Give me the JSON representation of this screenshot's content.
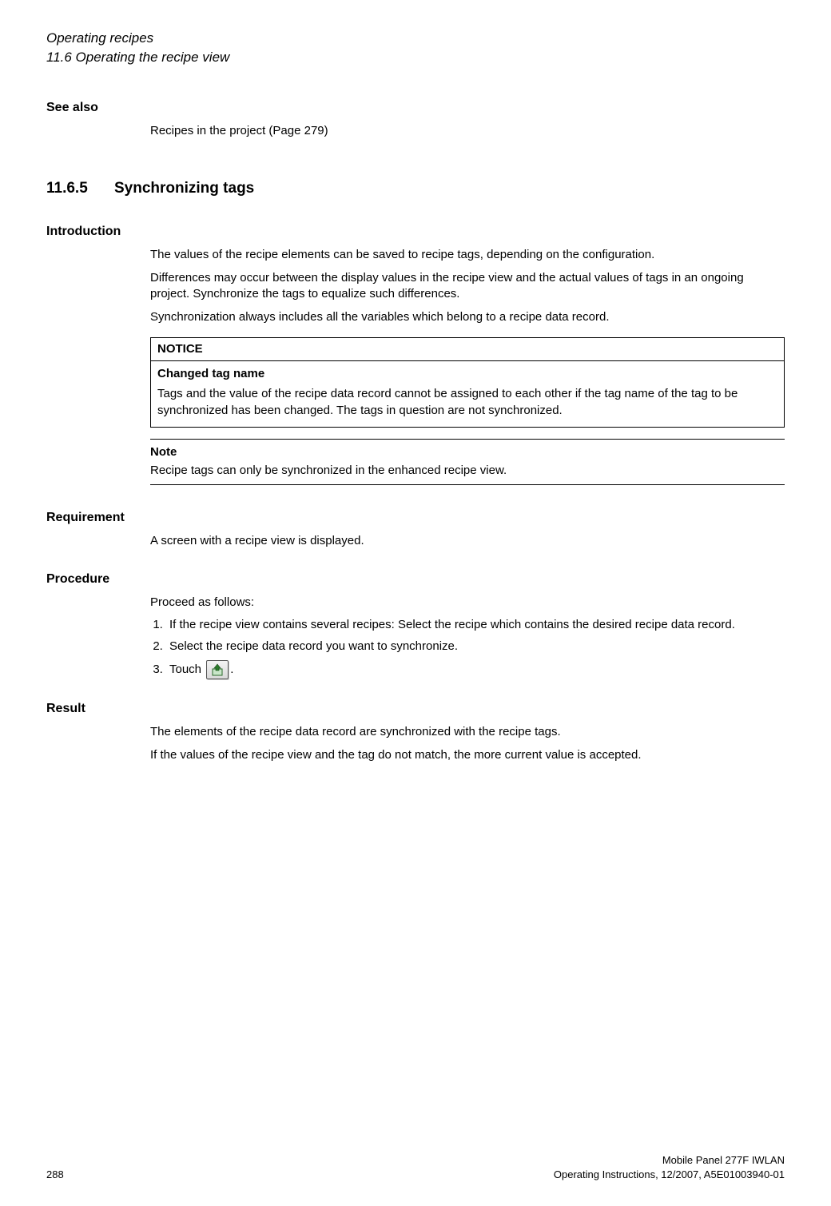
{
  "header": {
    "chapter": "Operating recipes",
    "section": "11.6 Operating the recipe view"
  },
  "see_also": {
    "heading": "See also",
    "text": "Recipes in the project (Page 279)"
  },
  "section_num": "11.6.5",
  "section_title": "Synchronizing tags",
  "introduction": {
    "heading": "Introduction",
    "p1": "The values of the recipe elements can be saved to recipe tags, depending on the configuration.",
    "p2": "Differences may occur between the display values in the recipe view and the actual values of tags in an ongoing project. Synchronize the tags to equalize such differences.",
    "p3": "Synchronization always includes all the variables which belong to a recipe data record."
  },
  "notice": {
    "label": "NOTICE",
    "sub": "Changed tag name",
    "body": "Tags and the value of the recipe data record cannot be assigned to each other if the tag name of the tag to be synchronized has been changed. The tags in question are not synchronized."
  },
  "note": {
    "label": "Note",
    "body": "Recipe tags can only be synchronized in the enhanced recipe view."
  },
  "requirement": {
    "heading": "Requirement",
    "text": "A screen with a recipe view is displayed."
  },
  "procedure": {
    "heading": "Procedure",
    "intro": "Proceed as follows:",
    "steps": [
      "If the recipe view contains several recipes: Select the recipe which contains the desired recipe data record.",
      "Select the recipe data record you want to synchronize."
    ],
    "step3_prefix": "Touch ",
    "step3_suffix": "."
  },
  "result": {
    "heading": "Result",
    "p1": "The elements of the recipe data record are synchronized with the recipe tags.",
    "p2": "If the values of the recipe view and the tag do not match, the more current value is accepted."
  },
  "footer": {
    "page": "288",
    "product": "Mobile Panel 277F IWLAN",
    "docinfo": "Operating Instructions, 12/2007, A5E01003940-01"
  }
}
